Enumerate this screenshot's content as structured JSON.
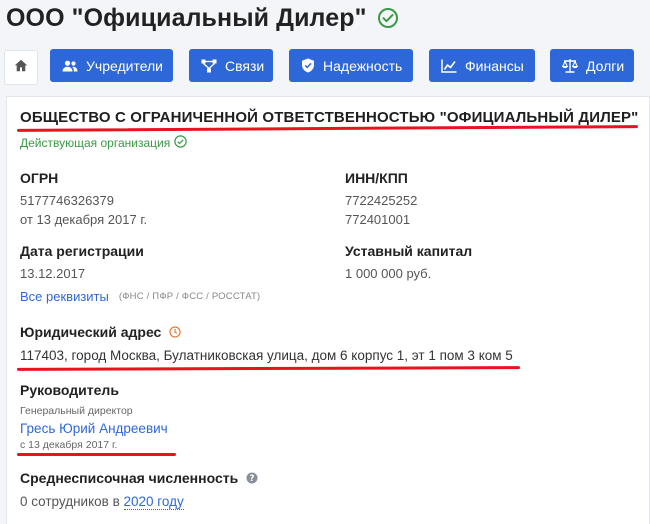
{
  "header": {
    "title": "ООО \"Официальный Дилер\""
  },
  "tabs": [
    {
      "label": "Учредители",
      "icon": "users-icon"
    },
    {
      "label": "Связи",
      "icon": "network-icon"
    },
    {
      "label": "Надежность",
      "icon": "shield-icon"
    },
    {
      "label": "Финансы",
      "icon": "chart-icon"
    },
    {
      "label": "Долги",
      "icon": "scales-icon"
    }
  ],
  "company": {
    "full_name": "ОБЩЕСТВО С ОГРАНИЧЕННОЙ ОТВЕТСТВЕННОСТЬЮ \"ОФИЦИАЛЬНЫЙ ДИЛЕР\"",
    "status": "Действующая организация"
  },
  "ogrn": {
    "label": "ОГРН",
    "value": "5177746326379",
    "date": "от 13 декабря 2017 г."
  },
  "inn_kpp": {
    "label": "ИНН/КПП",
    "inn": "7722425252",
    "kpp": "772401001"
  },
  "registration": {
    "label": "Дата регистрации",
    "value": "13.12.2017"
  },
  "capital": {
    "label": "Уставный капитал",
    "value": "1 000 000 руб."
  },
  "requisites": {
    "link": "Все реквизиты",
    "note": "(ФНС / ПФР / ФСС / РОССТАТ)"
  },
  "address": {
    "label": "Юридический адрес",
    "value": "117403, город Москва, Булатниковская улица, дом 6 корпус 1, эт 1 пом 3 ком 5"
  },
  "head": {
    "label": "Руководитель",
    "position": "Генеральный директор",
    "name": "Гресь Юрий Андреевич",
    "since": "с 13 декабря 2017 г."
  },
  "employees": {
    "label": "Среднесписочная численность",
    "prefix": "0 сотрудников в",
    "year": "2020 году"
  },
  "colors": {
    "accent": "#2e68d8",
    "active": "#3a9a45",
    "highlight": "#e8131e"
  }
}
